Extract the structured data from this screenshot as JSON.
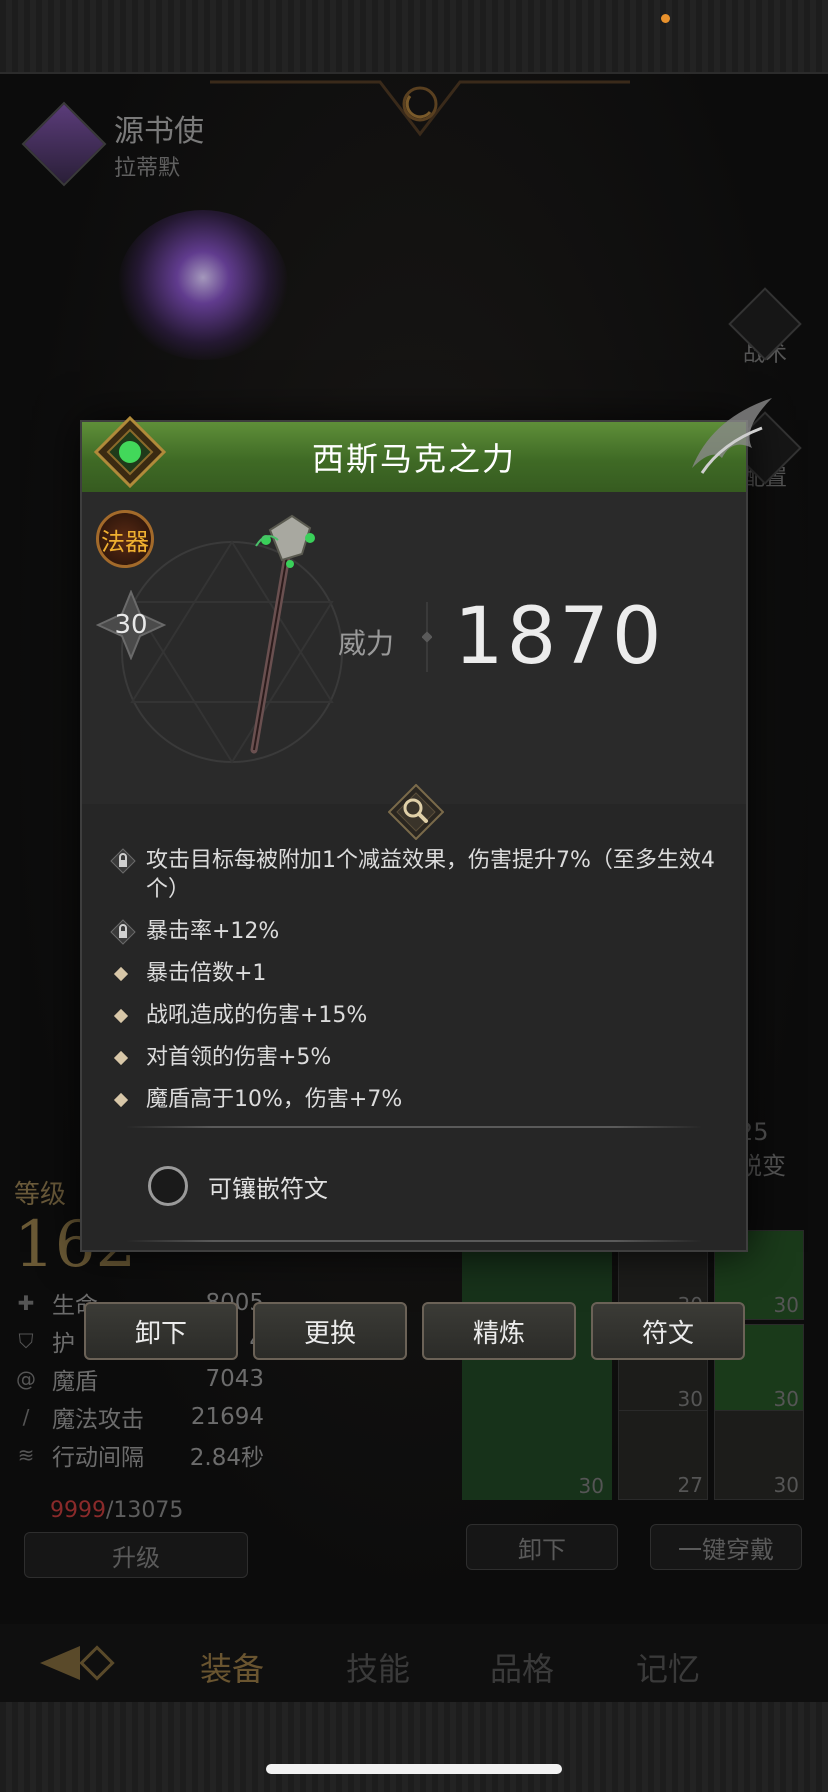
{
  "hero": {
    "name": "源书使",
    "sub_name": "拉蒂默"
  },
  "side_buttons": [
    {
      "label": "战术",
      "icon": "banner-icon"
    },
    {
      "label": "配置",
      "icon": "gear-icon"
    }
  ],
  "stats": {
    "level_label": "等级",
    "level": "162",
    "rows": [
      {
        "name": "生命",
        "value": "8005",
        "icon": "plus-icon"
      },
      {
        "name": "护",
        "value": "4",
        "icon": "shield-icon"
      },
      {
        "name": "魔盾",
        "value": "7043",
        "icon": "swirl-icon"
      },
      {
        "name": "魔法攻击",
        "value": "21694",
        "icon": "staff-icon"
      },
      {
        "name": "行动间隔",
        "value": "2.84秒",
        "icon": "wing-icon"
      }
    ]
  },
  "potion": {
    "current": "9999",
    "max": "/13075"
  },
  "bg_buttons": {
    "upgrade": "升级",
    "unequip": "卸下",
    "equip_all": "一键穿戴"
  },
  "evolve": {
    "level": "25",
    "label": "蜕变"
  },
  "slot_levels": [
    "30",
    "30",
    "30",
    "30",
    "27",
    "30"
  ],
  "weapon_slot_level": "30",
  "nav_tabs": [
    "装备",
    "技能",
    "品格",
    "记忆"
  ],
  "item": {
    "name": "西斯马克之力",
    "type": "法器",
    "level": "30",
    "power_label": "威力",
    "power": "1870",
    "effects": [
      {
        "icon": "lock-icon",
        "text": "攻击目标每被附加1个减益效果，伤害提升7%（至多生效4个）"
      },
      {
        "icon": "lock-icon",
        "text": "暴击率+12%"
      },
      {
        "icon": "diamond-icon",
        "text": "暴击倍数+1"
      },
      {
        "icon": "diamond-icon",
        "text": "战吼造成的伤害+15%"
      },
      {
        "icon": "diamond-icon",
        "text": "对首领的伤害+5%"
      },
      {
        "icon": "diamond-icon",
        "text": "魔盾高于10%，伤害+7%"
      }
    ],
    "rune_label": "可镶嵌符文"
  },
  "actions": {
    "unequip": "卸下",
    "replace": "更换",
    "refine": "精炼",
    "rune": "符文"
  },
  "colors": {
    "header_green": "#4a7a2e",
    "accent_gold": "#c9a14a",
    "potion_red": "#8a2a2a"
  }
}
